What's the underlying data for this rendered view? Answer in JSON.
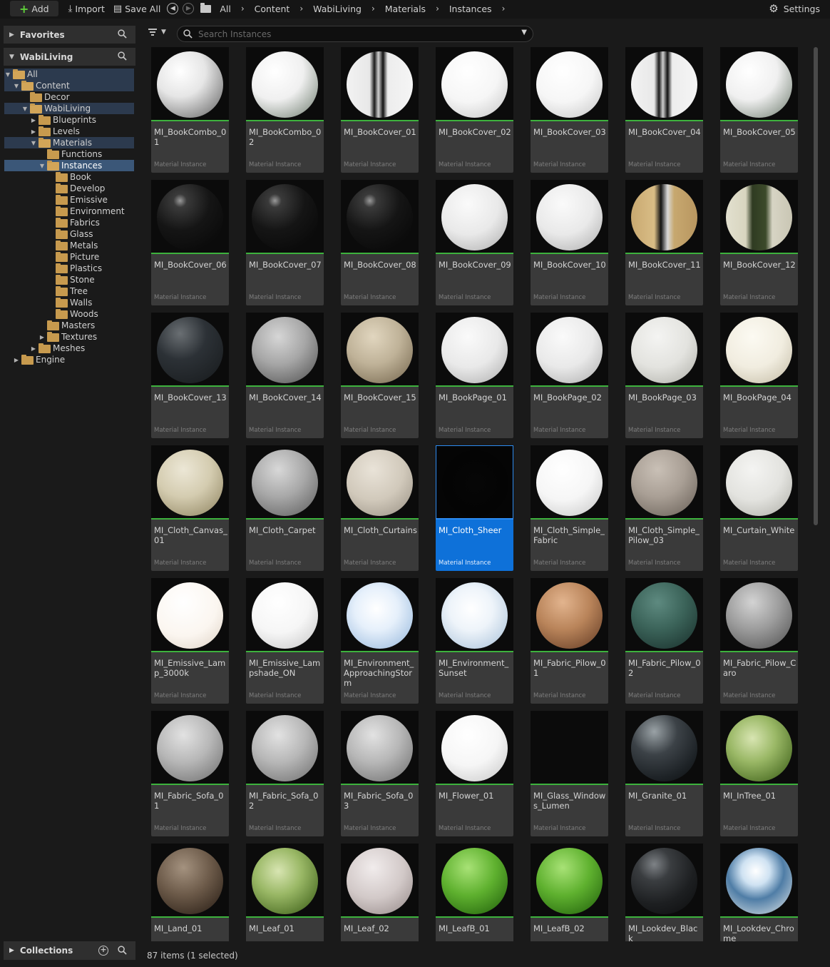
{
  "toolbar": {
    "add_label": "Add",
    "import_label": "Import",
    "save_all_label": "Save All",
    "breadcrumbs": [
      "All",
      "Content",
      "WabiLiving",
      "Materials",
      "Instances"
    ],
    "settings_label": "Settings"
  },
  "sidebar": {
    "favorites_label": "Favorites",
    "project_label": "WabiLiving",
    "collections_label": "Collections",
    "tree": [
      {
        "label": "All",
        "depth": 0,
        "expand": "open",
        "icon": "folder-open",
        "state": "sel"
      },
      {
        "label": "Content",
        "depth": 1,
        "expand": "open",
        "icon": "folder-open",
        "state": "sel"
      },
      {
        "label": "Decor",
        "depth": 2,
        "expand": "none",
        "icon": "folder",
        "state": ""
      },
      {
        "label": "WabiLiving",
        "depth": 2,
        "expand": "open",
        "icon": "folder-open",
        "state": "sel"
      },
      {
        "label": "Blueprints",
        "depth": 3,
        "expand": "closed",
        "icon": "folder",
        "state": ""
      },
      {
        "label": "Levels",
        "depth": 3,
        "expand": "closed",
        "icon": "folder",
        "state": ""
      },
      {
        "label": "Materials",
        "depth": 3,
        "expand": "open",
        "icon": "folder-open",
        "state": "sel"
      },
      {
        "label": "Functions",
        "depth": 4,
        "expand": "none",
        "icon": "folder",
        "state": ""
      },
      {
        "label": "Instances",
        "depth": 4,
        "expand": "open",
        "icon": "folder-open",
        "state": "active"
      },
      {
        "label": "Book",
        "depth": 5,
        "expand": "none",
        "icon": "folder",
        "state": ""
      },
      {
        "label": "Develop",
        "depth": 5,
        "expand": "none",
        "icon": "folder",
        "state": ""
      },
      {
        "label": "Emissive",
        "depth": 5,
        "expand": "none",
        "icon": "folder",
        "state": ""
      },
      {
        "label": "Environment",
        "depth": 5,
        "expand": "none",
        "icon": "folder",
        "state": ""
      },
      {
        "label": "Fabrics",
        "depth": 5,
        "expand": "none",
        "icon": "folder",
        "state": ""
      },
      {
        "label": "Glass",
        "depth": 5,
        "expand": "none",
        "icon": "folder",
        "state": ""
      },
      {
        "label": "Metals",
        "depth": 5,
        "expand": "none",
        "icon": "folder",
        "state": ""
      },
      {
        "label": "Picture",
        "depth": 5,
        "expand": "none",
        "icon": "folder",
        "state": ""
      },
      {
        "label": "Plastics",
        "depth": 5,
        "expand": "none",
        "icon": "folder",
        "state": ""
      },
      {
        "label": "Stone",
        "depth": 5,
        "expand": "none",
        "icon": "folder",
        "state": ""
      },
      {
        "label": "Tree",
        "depth": 5,
        "expand": "none",
        "icon": "folder",
        "state": ""
      },
      {
        "label": "Walls",
        "depth": 5,
        "expand": "none",
        "icon": "folder",
        "state": ""
      },
      {
        "label": "Woods",
        "depth": 5,
        "expand": "none",
        "icon": "folder",
        "state": ""
      },
      {
        "label": "Masters",
        "depth": 4,
        "expand": "none",
        "icon": "folder",
        "state": ""
      },
      {
        "label": "Textures",
        "depth": 4,
        "expand": "closed",
        "icon": "folder",
        "state": ""
      },
      {
        "label": "Meshes",
        "depth": 3,
        "expand": "closed",
        "icon": "folder",
        "state": ""
      },
      {
        "label": "Engine",
        "depth": 1,
        "expand": "closed",
        "icon": "folder",
        "state": ""
      }
    ]
  },
  "search": {
    "placeholder": "Search Instances",
    "value": ""
  },
  "asset_type_label": "Material Instance",
  "assets": [
    {
      "name": "MI_BookCombo_01",
      "look": "combo1"
    },
    {
      "name": "MI_BookCombo_02",
      "look": "combo2"
    },
    {
      "name": "MI_BookCover_01",
      "look": "stripe"
    },
    {
      "name": "MI_BookCover_02",
      "look": "white"
    },
    {
      "name": "MI_BookCover_03",
      "look": "white"
    },
    {
      "name": "MI_BookCover_04",
      "look": "stripe"
    },
    {
      "name": "MI_BookCover_05",
      "look": "combo2"
    },
    {
      "name": "MI_BookCover_06",
      "look": "blackglossy"
    },
    {
      "name": "MI_BookCover_07",
      "look": "blackglossy"
    },
    {
      "name": "MI_BookCover_08",
      "look": "blackglossy"
    },
    {
      "name": "MI_BookCover_09",
      "look": "paper"
    },
    {
      "name": "MI_BookCover_10",
      "look": "paper"
    },
    {
      "name": "MI_BookCover_11",
      "look": "kraft"
    },
    {
      "name": "MI_BookCover_12",
      "look": "greenbook"
    },
    {
      "name": "MI_BookCover_13",
      "look": "darkbook"
    },
    {
      "name": "MI_BookCover_14",
      "look": "grey"
    },
    {
      "name": "MI_BookCover_15",
      "look": "tan"
    },
    {
      "name": "MI_BookPage_01",
      "look": "paper"
    },
    {
      "name": "MI_BookPage_02",
      "look": "paper"
    },
    {
      "name": "MI_BookPage_03",
      "look": "offwhite"
    },
    {
      "name": "MI_BookPage_04",
      "look": "cream"
    },
    {
      "name": "MI_Cloth_Canvas_01",
      "look": "canvas"
    },
    {
      "name": "MI_Cloth_Carpet",
      "look": "carpet"
    },
    {
      "name": "MI_Cloth_Curtains",
      "look": "curtain"
    },
    {
      "name": "MI_Cloth_Sheer",
      "look": "black"
    },
    {
      "name": "MI_Cloth_Simple_Fabric",
      "look": "white"
    },
    {
      "name": "MI_Cloth_Simple_Pilow_03",
      "look": "taupe"
    },
    {
      "name": "MI_Curtain_White",
      "look": "offwhite"
    },
    {
      "name": "MI_Emissive_Lamp_3000k",
      "look": "warmwhite"
    },
    {
      "name": "MI_Emissive_Lampshade_ON",
      "look": "white"
    },
    {
      "name": "MI_Environment_ApproachingStorm",
      "look": "sky"
    },
    {
      "name": "MI_Environment_Sunset",
      "look": "sky2"
    },
    {
      "name": "MI_Fabric_Pilow_01",
      "look": "rust"
    },
    {
      "name": "MI_Fabric_Pilow_02",
      "look": "teal"
    },
    {
      "name": "MI_Fabric_Pilow_Caro",
      "look": "caro"
    },
    {
      "name": "MI_Fabric_Sofa_01",
      "look": "sofa"
    },
    {
      "name": "MI_Fabric_Sofa_02",
      "look": "sofa"
    },
    {
      "name": "MI_Fabric_Sofa_03",
      "look": "sofa"
    },
    {
      "name": "MI_Flower_01",
      "look": "white"
    },
    {
      "name": "MI_Glass_Windows_Lumen",
      "look": "none"
    },
    {
      "name": "MI_Granite_01",
      "look": "granite"
    },
    {
      "name": "MI_InTree_01",
      "look": "leaf"
    },
    {
      "name": "MI_Land_01",
      "look": "land"
    },
    {
      "name": "MI_Leaf_01",
      "look": "leaf"
    },
    {
      "name": "MI_Leaf_02",
      "look": "pinkgrey"
    },
    {
      "name": "MI_LeafB_01",
      "look": "leafb"
    },
    {
      "name": "MI_LeafB_02",
      "look": "leafb"
    },
    {
      "name": "MI_Lookdev_Black",
      "look": "lookblack"
    },
    {
      "name": "MI_Lookdev_Chrome",
      "look": "chrome"
    }
  ],
  "selected_asset": "MI_Cloth_Sheer",
  "status_text": "87 items (1 selected)",
  "colors": {
    "accent": "#0e71d9",
    "valid_bar": "#3db23d",
    "folder": "#c79a4e"
  }
}
